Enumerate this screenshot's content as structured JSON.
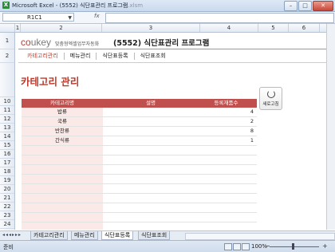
{
  "window": {
    "title": "Microsoft Excel - (5552) 식단표관리 프로그램",
    "title_ext": ".xlsm",
    "min": "–",
    "max": "□",
    "close": "✕"
  },
  "formula_bar": {
    "name_box": "R1C1",
    "fx": "fx",
    "value": ""
  },
  "columns": [
    "1",
    "2",
    "3",
    "4",
    "5",
    "6"
  ],
  "rows": [
    "1",
    "2",
    "",
    "",
    "",
    "",
    "10",
    "11",
    "12",
    "13",
    "14",
    "15",
    "16",
    "17",
    "18",
    "19",
    "20",
    "21",
    "22",
    "23",
    "24"
  ],
  "brand": {
    "logo": "coukey",
    "tagline": "맞춤형엑셀업무자동화"
  },
  "app_title": "(5552) 식단표관리 프로그램",
  "menu": [
    "카테고리관리",
    "메뉴관리",
    "식단표등록",
    "식단표조회"
  ],
  "page_title": "카테고리 관리",
  "refresh_label": "새로고침",
  "table": {
    "headers": [
      "카테고리명",
      "설명",
      "등록재품수"
    ],
    "rows": [
      [
        "밥류",
        "",
        "4"
      ],
      [
        "국류",
        "",
        "2"
      ],
      [
        "반찬류",
        "",
        "8"
      ],
      [
        "간식류",
        "",
        "1"
      ],
      [
        "",
        "",
        ""
      ],
      [
        "",
        "",
        ""
      ],
      [
        "",
        "",
        ""
      ],
      [
        "",
        "",
        ""
      ],
      [
        "",
        "",
        ""
      ],
      [
        "",
        "",
        ""
      ],
      [
        "",
        "",
        ""
      ],
      [
        "",
        "",
        ""
      ],
      [
        "",
        "",
        ""
      ],
      [
        "",
        "",
        ""
      ]
    ]
  },
  "sheet_tabs": [
    "카테고리관리",
    "메뉴관리",
    "식단표등록",
    "식단표조회"
  ],
  "active_tab": "식단표등록",
  "status": {
    "ready": "준비",
    "zoom": "100%"
  }
}
